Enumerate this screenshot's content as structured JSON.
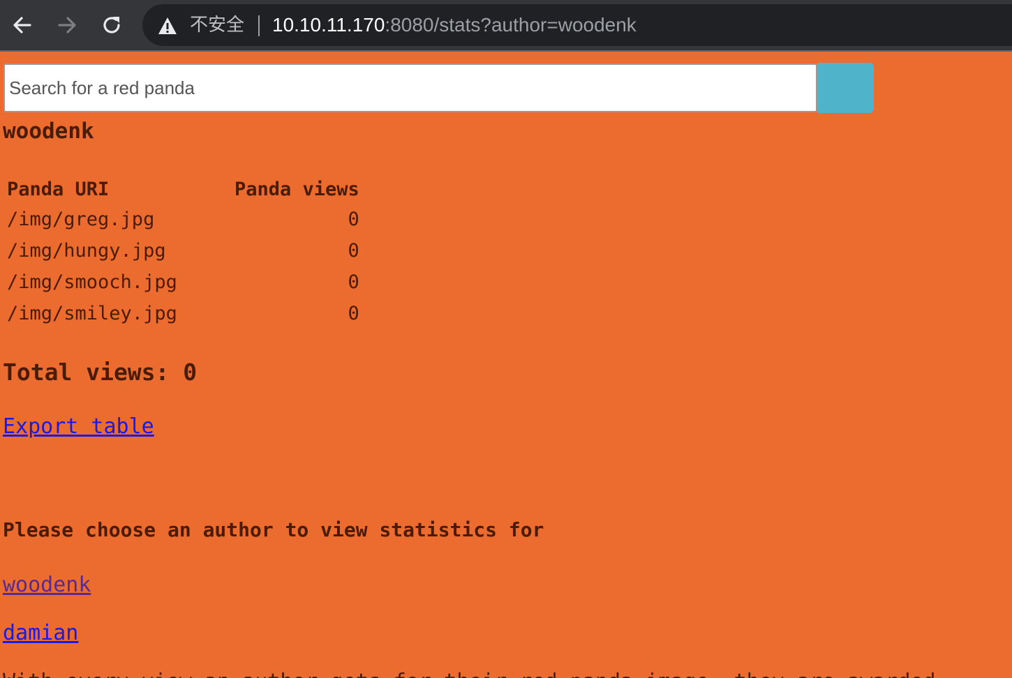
{
  "browser": {
    "security_label": "不安全",
    "url_host": "10.10.11.170",
    "url_rest": ":8080/stats?author=woodenk",
    "icons": {
      "back": "back-arrow-icon",
      "forward": "forward-arrow-icon",
      "reload": "reload-icon",
      "security": "warning-triangle-icon"
    },
    "colors": {
      "chrome": "#35363a",
      "omnibox": "#202124"
    }
  },
  "search": {
    "placeholder": "Search for a red panda",
    "button_color": "#4fb3c9"
  },
  "stats": {
    "author": "woodenk",
    "columns": [
      "Panda URI",
      "Panda views"
    ],
    "rows": [
      {
        "uri": "/img/greg.jpg",
        "views": "0"
      },
      {
        "uri": "/img/hungy.jpg",
        "views": "0"
      },
      {
        "uri": "/img/smooch.jpg",
        "views": "0"
      },
      {
        "uri": "/img/smiley.jpg",
        "views": "0"
      }
    ],
    "total_label": "Total views:",
    "total_value": "0",
    "export_label": "Export table"
  },
  "authors": {
    "heading": "Please choose an author to view statistics for",
    "list": [
      "woodenk",
      "damian"
    ]
  },
  "cut_off_text": "With every view an author gets for their red panda image, they are awarded",
  "page": {
    "background": "#ec6b2f",
    "text_color": "#4a1c06",
    "link_color": "#1a1ae6",
    "visited_link_color": "#5b2a8f"
  }
}
